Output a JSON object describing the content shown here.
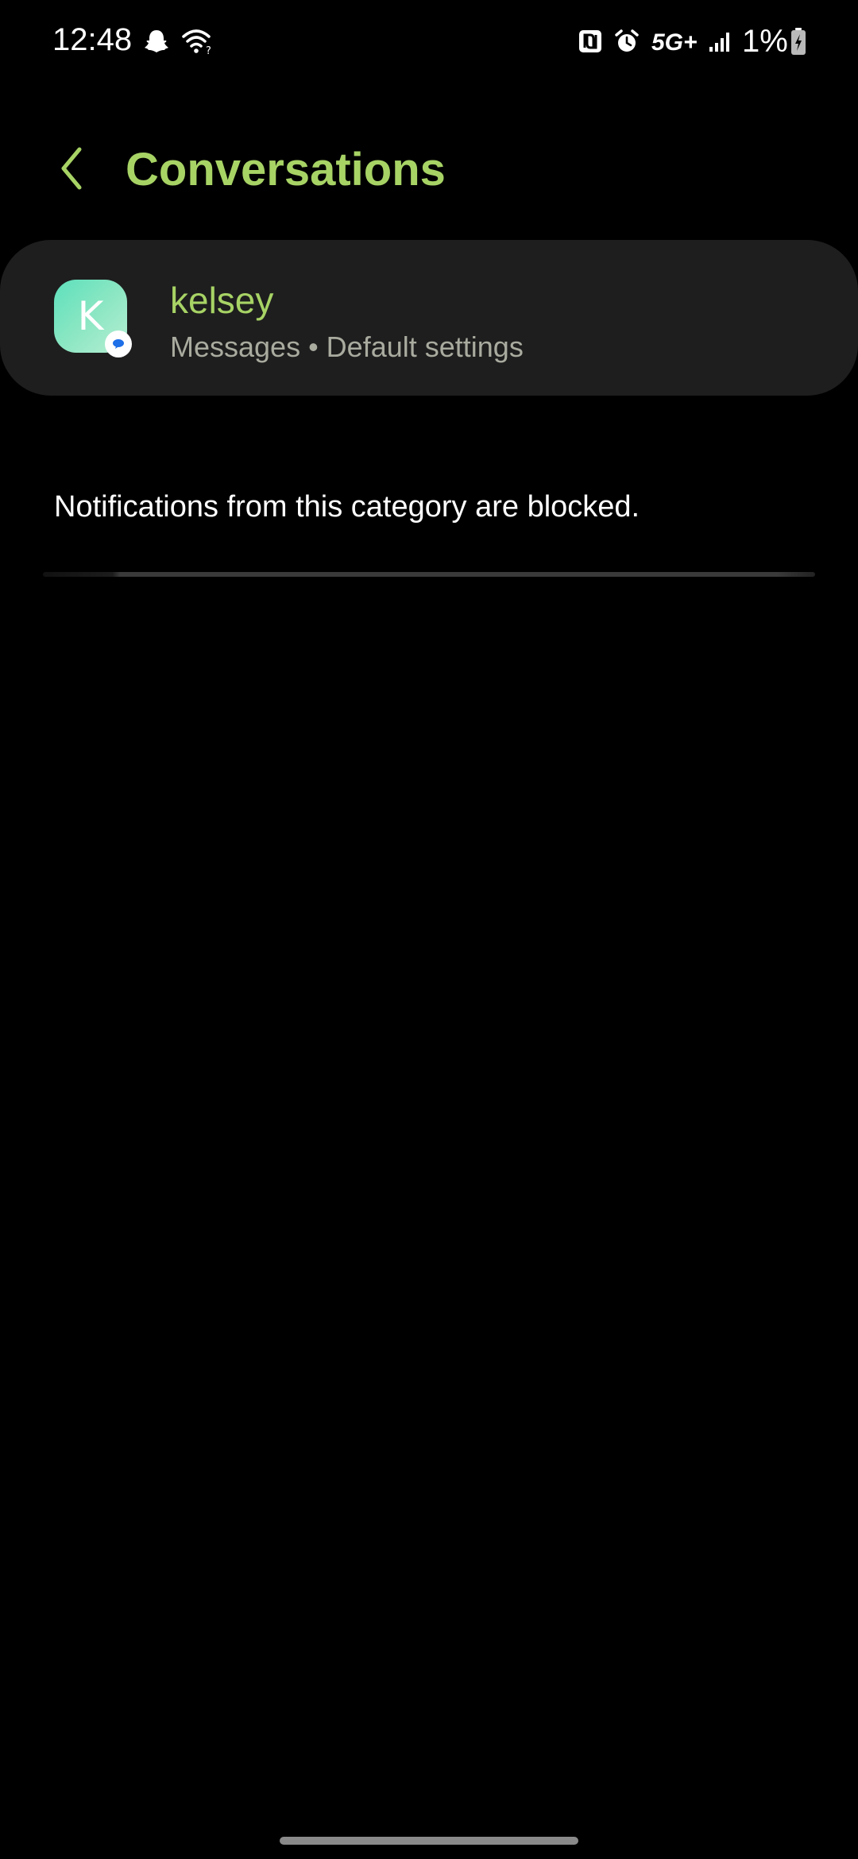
{
  "status_bar": {
    "time": "12:48",
    "network_type": "5G+",
    "battery_percent": "1%",
    "icons": [
      "snapchat-icon",
      "wifi-icon",
      "nfc-icon",
      "alarm-icon",
      "signal-icon",
      "battery-charging-icon"
    ]
  },
  "header": {
    "title": "Conversations",
    "back_icon": "chevron-left-icon"
  },
  "conversation": {
    "avatar_letter": "K",
    "name": "kelsey",
    "subtitle": "Messages • Default settings",
    "badge_icon": "messages-app-icon"
  },
  "notice": {
    "text": "Notifications from this category are blocked."
  },
  "colors": {
    "accent": "#a7d365",
    "card_background": "#1e1e1e",
    "subtitle_text": "#a9ab9f",
    "avatar_gradient_start": "#5de0bb",
    "avatar_gradient_end": "#b6efd3",
    "background": "#000000"
  }
}
